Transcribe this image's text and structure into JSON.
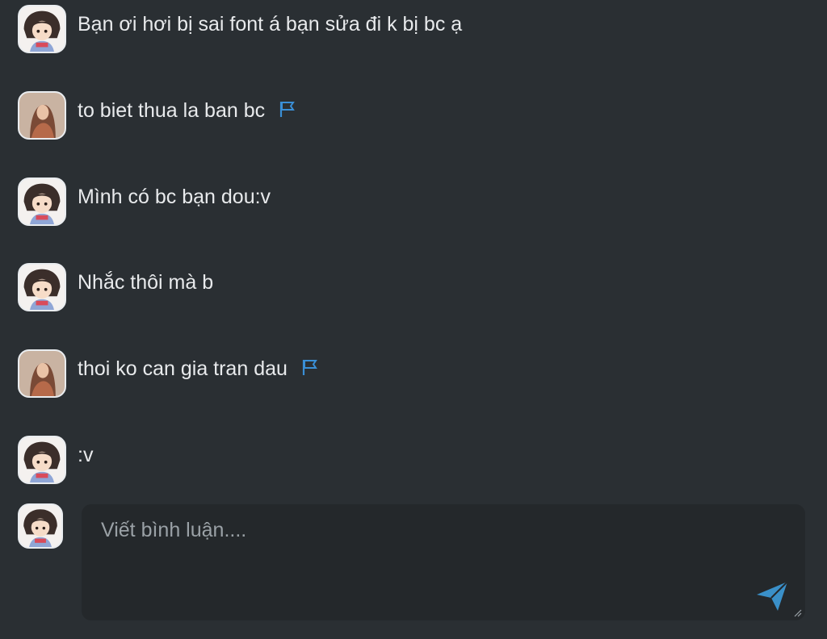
{
  "comments": [
    {
      "avatar": "anime-girl-avatar",
      "text": "Bạn ơi hơi bị sai font á bạn sửa đi k bị bc ạ",
      "flagged": false
    },
    {
      "avatar": "woman-photo-avatar",
      "text": "to biet thua la ban bc",
      "flagged": true
    },
    {
      "avatar": "anime-girl-avatar",
      "text": "Mình có bc bạn dou:v",
      "flagged": false
    },
    {
      "avatar": "anime-girl-avatar",
      "text": "Nhắc thôi mà b",
      "flagged": false
    },
    {
      "avatar": "woman-photo-avatar",
      "text": "thoi ko can gia tran dau",
      "flagged": true
    },
    {
      "avatar": "anime-girl-avatar",
      "text": ":v",
      "flagged": false
    }
  ],
  "composer": {
    "placeholder": "Viết bình luận....",
    "value": "",
    "avatar": "anime-girl-avatar",
    "send_icon": "send-icon"
  },
  "colors": {
    "background": "#2a2f33",
    "composer_bg": "#24282b",
    "flag": "#3a8fd6",
    "send": "#3a90c9"
  }
}
